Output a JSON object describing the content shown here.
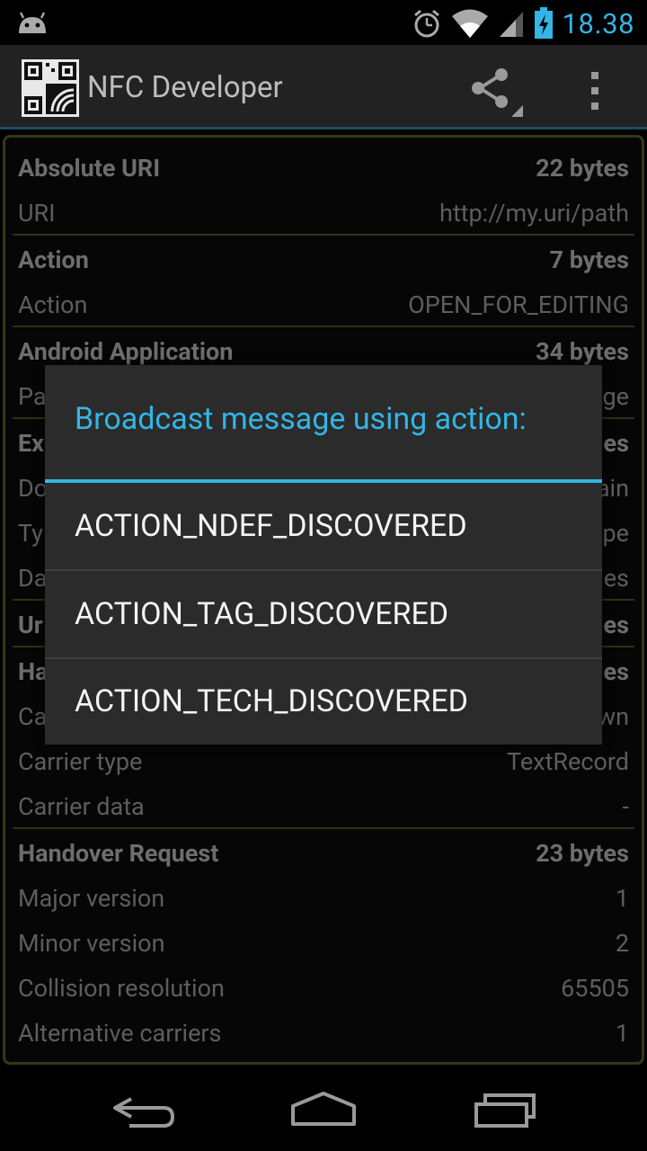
{
  "status": {
    "time": "18.38"
  },
  "app": {
    "title": "NFC Developer"
  },
  "records": {
    "rows": [
      {
        "label": "Absolute URI",
        "value": "22 bytes"
      },
      {
        "label": "URI",
        "value": "http://my.uri/path"
      },
      {
        "label": "Action",
        "value": "7 bytes"
      },
      {
        "label": "Action",
        "value": "OPEN_FOR_EDITING"
      },
      {
        "label": "Android Application",
        "value": "34 bytes"
      },
      {
        "label": "Pa",
        "value": "ge"
      },
      {
        "label": "Ex",
        "value": "es"
      },
      {
        "label": "Do",
        "value": "ain"
      },
      {
        "label": "Ty",
        "value": "pe"
      },
      {
        "label": "Da",
        "value": "es"
      },
      {
        "label": "Ur",
        "value": "es"
      },
      {
        "label": "Ha",
        "value": "es"
      },
      {
        "label": "Ca",
        "value": "wn"
      },
      {
        "label": "Carrier type",
        "value": "TextRecord"
      },
      {
        "label": "Carrier data",
        "value": "-"
      },
      {
        "label": "Handover Request",
        "value": "23 bytes"
      },
      {
        "label": "Major version",
        "value": "1"
      },
      {
        "label": "Minor version",
        "value": "2"
      },
      {
        "label": "Collision resolution",
        "value": "65505"
      },
      {
        "label": "Alternative carriers",
        "value": "1"
      }
    ]
  },
  "dialog": {
    "title": "Broadcast message using action:",
    "options": [
      {
        "label": "ACTION_NDEF_DISCOVERED"
      },
      {
        "label": "ACTION_TAG_DISCOVERED"
      },
      {
        "label": "ACTION_TECH_DISCOVERED"
      }
    ]
  },
  "icons": {
    "android": "android-icon",
    "alarm": "alarm-icon",
    "wifi": "wifi-icon",
    "signal": "signal-icon",
    "battery": "battery-charging-icon",
    "share": "share-icon",
    "overflow": "overflow-menu-icon",
    "back": "back-icon",
    "home": "home-icon",
    "recents": "recents-icon"
  },
  "colors": {
    "accent": "#33b5e5",
    "frame": "#555522"
  }
}
